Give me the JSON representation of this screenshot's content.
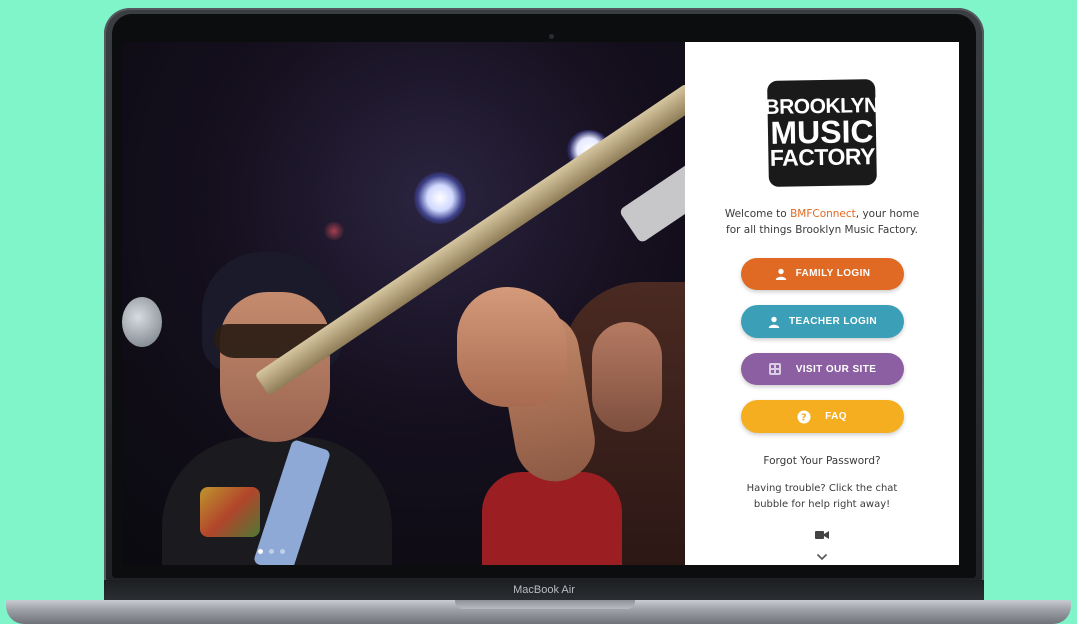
{
  "device": {
    "label": "MacBook Air",
    "background_color": "#7ff5c9"
  },
  "slider": {
    "slides": 3,
    "active_index": 0
  },
  "logo": {
    "line1": "BROOKLYN",
    "line2": "MUSIC",
    "line3": "FACTORY"
  },
  "welcome": {
    "prefix": "Welcome to ",
    "brand": "BMFConnect",
    "suffix": ", your home for all things Brooklyn Music Factory."
  },
  "buttons": {
    "family": {
      "label": "FAMILY LOGIN",
      "icon": "user-icon",
      "color": "#e06a23"
    },
    "teacher": {
      "label": "TEACHER LOGIN",
      "icon": "user-icon",
      "color": "#3a9fb7"
    },
    "visit": {
      "label": "VISIT OUR SITE",
      "icon": "site-icon",
      "color": "#8b5fa1"
    },
    "faq": {
      "label": "FAQ",
      "icon": "question-icon",
      "color": "#f4ae20"
    }
  },
  "forgot_password": "Forgot Your Password?",
  "trouble_text": "Having trouble? Click the chat bubble for help right away!",
  "icons": {
    "video": "video-camera-icon",
    "scroll": "chevron-down-icon"
  }
}
